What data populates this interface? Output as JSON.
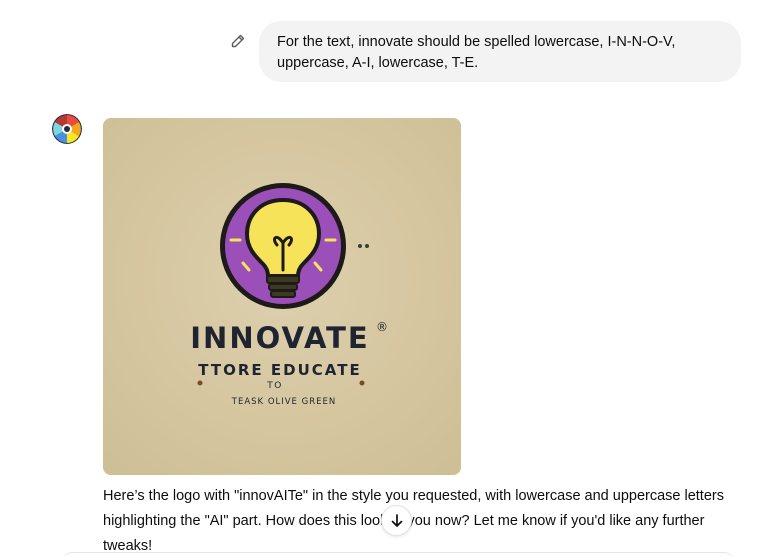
{
  "conversation": {
    "user_message": {
      "text": "For the text, innovate should be spelled lowercase, I-N-N-O-V, uppercase, A-I, lowercase, T-E.",
      "edit_icon": "pencil-icon"
    },
    "assistant_message": {
      "avatar_icon": "swirl-logo-icon",
      "image": {
        "background_color": "#d6c7a1",
        "circle_color": "#9b4fb8",
        "bulb_color": "#f6e35a",
        "brand_text": "INNOVATE",
        "trademark": "®",
        "line1": "TTORE EDUCATE",
        "line2": "TO",
        "line3": "TEASK OLIVE GREEN"
      },
      "text": "Here’s the logo with \"innovAITe\" in the style you requested, with lowercase and uppercase letters highlighting the \"AI\" part. How does this look to you now? Let me know if you'd like any further tweaks!"
    }
  },
  "controls": {
    "scroll_down_icon": "arrow-down-icon"
  }
}
